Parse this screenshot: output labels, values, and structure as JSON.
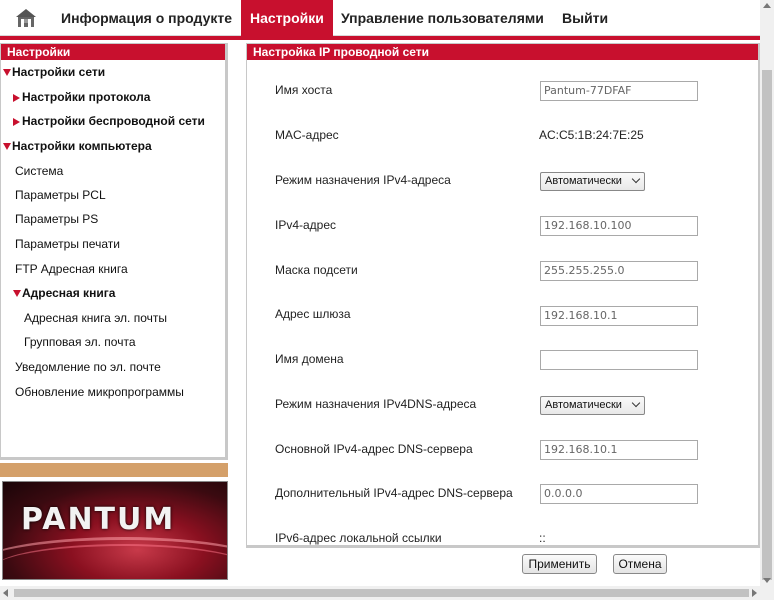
{
  "colors": {
    "accent": "#c8102e",
    "tan": "#d4a06a"
  },
  "nav": {
    "home_icon": "home-icon",
    "items": [
      {
        "label": "Информация о продукте"
      },
      {
        "label": "Настройки",
        "active": true
      },
      {
        "label": "Управление пользователями"
      },
      {
        "label": "Выйти"
      }
    ]
  },
  "sidebar": {
    "title": "Настройки",
    "items": [
      {
        "label": "Настройки сети",
        "marker": "expanded"
      },
      {
        "label": "Настройки протокола",
        "marker": "collapsed"
      },
      {
        "label": "Настройки беспроводной сети",
        "marker": "collapsed"
      },
      {
        "label": "Настройки компьютера",
        "marker": "expanded"
      },
      {
        "label": "Система"
      },
      {
        "label": "Параметры PCL"
      },
      {
        "label": "Параметры PS"
      },
      {
        "label": "Параметры печати"
      },
      {
        "label": "FTP Адресная книга"
      },
      {
        "label": "Адресная книга",
        "marker": "expanded"
      },
      {
        "label": "Адресная книга эл. почты"
      },
      {
        "label": "Групповая эл. почта"
      },
      {
        "label": "Уведомление по эл. почте"
      },
      {
        "label": "Обновление микропрограммы"
      }
    ],
    "logo_text": "PANTUM"
  },
  "panel": {
    "title": "Настройка IP проводной сети",
    "rows": [
      {
        "label": "Имя хоста",
        "type": "input",
        "value": "Pantum-77DFAF"
      },
      {
        "label": "MAC-адрес",
        "type": "text",
        "value": "AC:C5:1B:24:7E:25"
      },
      {
        "label": "Режим назначения IPv4-адреса",
        "type": "select",
        "value": "Автоматически"
      },
      {
        "label": "IPv4-адрес",
        "type": "input",
        "value": "192.168.10.100"
      },
      {
        "label": "Маска подсети",
        "type": "input",
        "value": "255.255.255.0"
      },
      {
        "label": "Адрес шлюза",
        "type": "input",
        "value": "192.168.10.1"
      },
      {
        "label": "Имя домена",
        "type": "input",
        "value": ""
      },
      {
        "label": "Режим назначения IPv4DNS-адреса",
        "type": "select",
        "value": "Автоматически"
      },
      {
        "label": "Основной IPv4-адрес DNS-сервера",
        "type": "input",
        "value": "192.168.10.1"
      },
      {
        "label": "Дополнительный IPv4-адрес DNS-сервера",
        "type": "input",
        "value": "0.0.0.0"
      },
      {
        "label": "IPv6-адрес локальной ссылки",
        "type": "text",
        "value": "::"
      }
    ]
  },
  "buttons": {
    "apply": "Применить",
    "cancel": "Отмена"
  }
}
